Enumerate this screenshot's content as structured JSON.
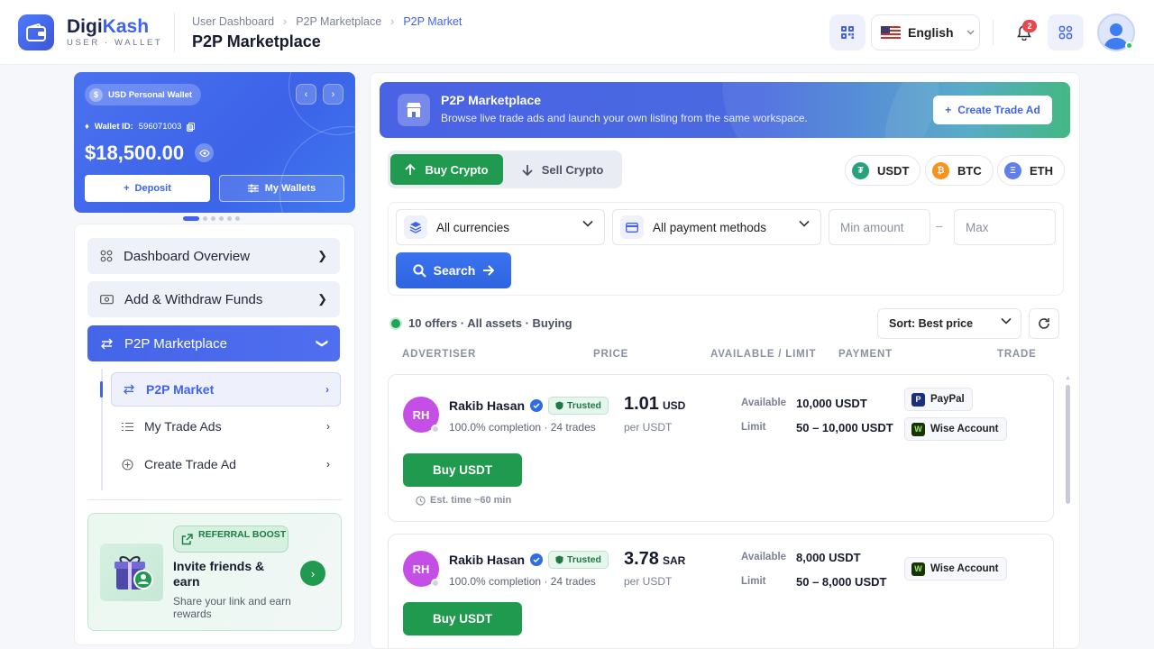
{
  "brand": {
    "name_a": "Digi",
    "name_b": "Kash",
    "subtitle": "USER · WALLET"
  },
  "breadcrumb": [
    "User Dashboard",
    "P2P Marketplace",
    "P2P Market"
  ],
  "page_title": "P2P Marketplace",
  "header": {
    "language": "English",
    "notification_count": "2"
  },
  "wallet": {
    "chip": "USD Personal Wallet",
    "id_label": "Wallet ID:",
    "id_value": "596071003",
    "balance": "$18,500.00",
    "deposit": "Deposit",
    "my_wallets": "My Wallets"
  },
  "nav": {
    "items": [
      {
        "label": "Dashboard Overview"
      },
      {
        "label": "Add & Withdraw Funds"
      },
      {
        "label": "P2P Marketplace"
      }
    ],
    "sub": [
      {
        "label": "P2P Market"
      },
      {
        "label": "My Trade Ads"
      },
      {
        "label": "Create Trade Ad"
      }
    ]
  },
  "referral": {
    "tag": "REFERRAL BOOST",
    "title": "Invite friends & earn",
    "subtitle": "Share your link and earn rewards"
  },
  "banner": {
    "title": "P2P Marketplace",
    "subtitle": "Browse live trade ads and launch your own listing from the same workspace.",
    "button": "Create Trade Ad"
  },
  "tabs": {
    "buy": "Buy Crypto",
    "sell": "Sell Crypto"
  },
  "coins": [
    {
      "label": "USDT",
      "symbol": "₮",
      "color": "#26a17b"
    },
    {
      "label": "BTC",
      "symbol": "₿",
      "color": "#f7931a"
    },
    {
      "label": "ETH",
      "symbol": "Ξ",
      "color": "#627eea"
    }
  ],
  "filters": {
    "currency": "All currencies",
    "payment": "All payment methods",
    "min_placeholder": "Min amount",
    "max_placeholder": "Max",
    "separator": "–",
    "search": "Search"
  },
  "results": {
    "summary": "10 offers · All assets · Buying",
    "sort": "Sort: Best price"
  },
  "columns": {
    "advertiser": "ADVERTISER",
    "price": "PRICE",
    "available": "AVAILABLE / LIMIT",
    "payment": "PAYMENT",
    "trade": "TRADE"
  },
  "offers": [
    {
      "initials": "RH",
      "name": "Rakib Hasan",
      "badge": "Trusted",
      "stats": "100.0% completion · 24 trades",
      "price": "1.01",
      "currency": "USD",
      "per": "per USDT",
      "available_label": "Available",
      "available": "10,000 USDT",
      "limit_label": "Limit",
      "limit": "50 – 10,000 USDT",
      "payments": [
        "PayPal",
        "Wise Account"
      ],
      "button": "Buy USDT",
      "est": "Est. time ~60 min"
    },
    {
      "initials": "RH",
      "name": "Rakib Hasan",
      "badge": "Trusted",
      "stats": "100.0% completion · 24 trades",
      "price": "3.78",
      "currency": "SAR",
      "per": "per USDT",
      "available_label": "Available",
      "available": "8,000 USDT",
      "limit_label": "Limit",
      "limit": "50 – 8,000 USDT",
      "payments": [
        "Wise Account"
      ],
      "button": "Buy USDT"
    }
  ]
}
